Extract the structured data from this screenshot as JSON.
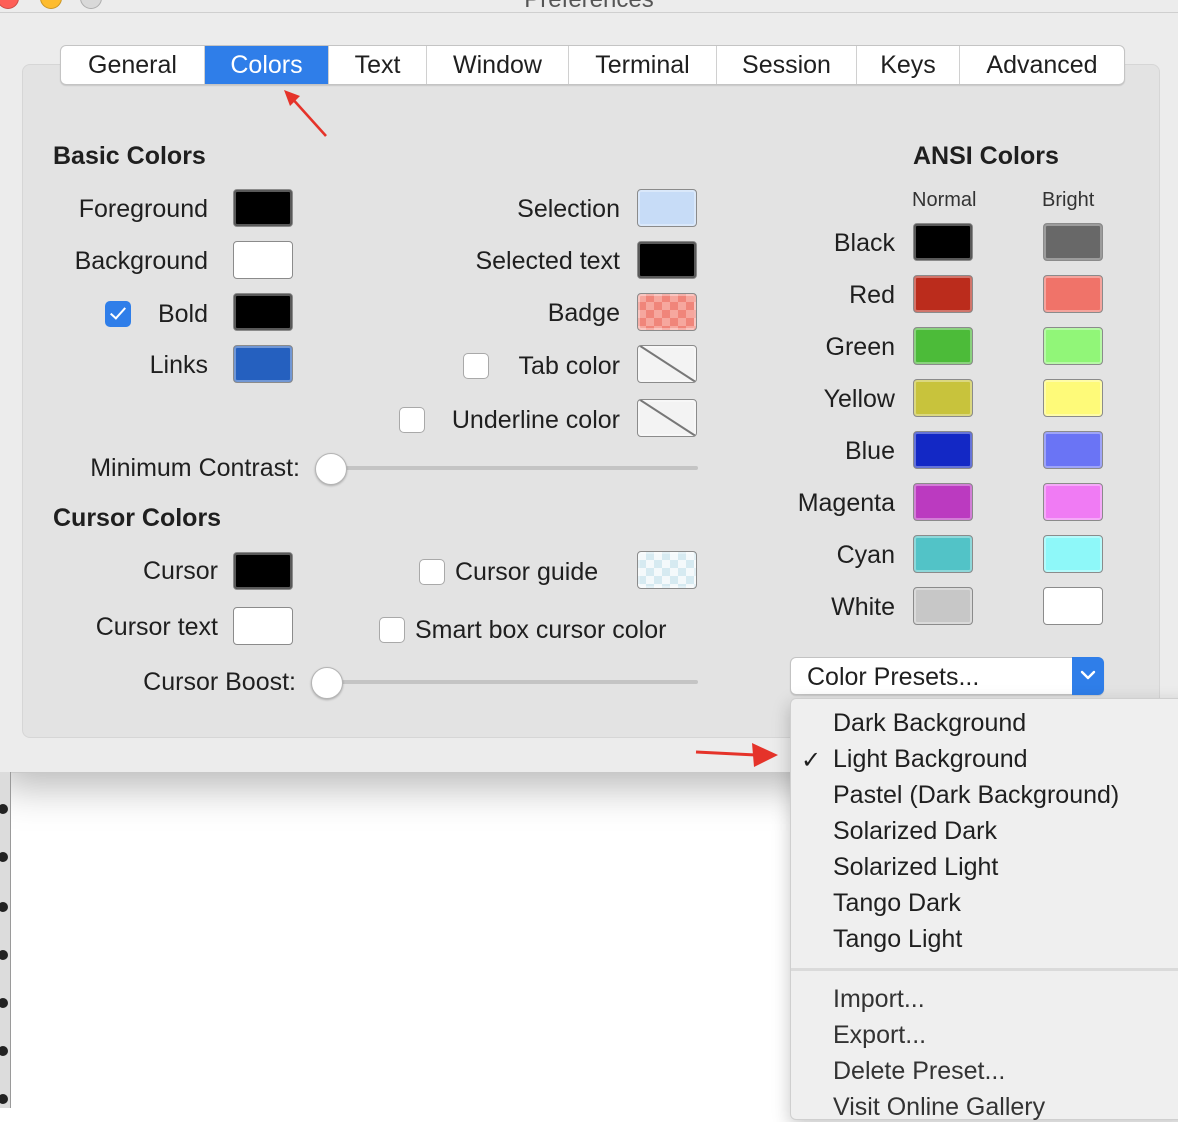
{
  "window": {
    "title": "Preferences"
  },
  "tabs": [
    {
      "label": "General",
      "active": false
    },
    {
      "label": "Colors",
      "active": true
    },
    {
      "label": "Text",
      "active": false
    },
    {
      "label": "Window",
      "active": false
    },
    {
      "label": "Terminal",
      "active": false
    },
    {
      "label": "Session",
      "active": false
    },
    {
      "label": "Keys",
      "active": false
    },
    {
      "label": "Advanced",
      "active": false
    }
  ],
  "basic_colors": {
    "heading": "Basic Colors",
    "foreground": {
      "label": "Foreground",
      "color": "#000000"
    },
    "background": {
      "label": "Background",
      "color": "#ffffff"
    },
    "bold": {
      "label": "Bold",
      "color": "#000000",
      "checked": true
    },
    "links": {
      "label": "Links",
      "color": "#2560bf"
    },
    "selection": {
      "label": "Selection",
      "color": "#c7dcf7"
    },
    "selected_text": {
      "label": "Selected text",
      "color": "#000000"
    },
    "badge": {
      "label": "Badge",
      "color": "#f0857a"
    },
    "tab_color": {
      "label": "Tab color",
      "checked": false
    },
    "underline_color": {
      "label": "Underline color",
      "checked": false
    },
    "min_contrast": {
      "label": "Minimum Contrast:",
      "value": 0
    }
  },
  "cursor_colors": {
    "heading": "Cursor Colors",
    "cursor": {
      "label": "Cursor",
      "color": "#000000"
    },
    "cursor_text": {
      "label": "Cursor text",
      "color": "#ffffff"
    },
    "cursor_guide": {
      "label": "Cursor guide",
      "checked": false,
      "color": "#d6eaf1"
    },
    "smart_box": {
      "label": "Smart box cursor color",
      "checked": false
    },
    "cursor_boost": {
      "label": "Cursor Boost:",
      "value": 0
    }
  },
  "ansi": {
    "heading": "ANSI Colors",
    "normal_label": "Normal",
    "bright_label": "Bright",
    "rows": [
      {
        "name": "Black",
        "normal": "#000000",
        "bright": "#686868"
      },
      {
        "name": "Red",
        "normal": "#bb2c1c",
        "bright": "#f07369"
      },
      {
        "name": "Green",
        "normal": "#4cbb39",
        "bright": "#91f678"
      },
      {
        "name": "Yellow",
        "normal": "#c8c33c",
        "bright": "#fefa79"
      },
      {
        "name": "Blue",
        "normal": "#1328c5",
        "bright": "#6a74f5"
      },
      {
        "name": "Magenta",
        "normal": "#bb3ac0",
        "bright": "#f07bf4"
      },
      {
        "name": "Cyan",
        "normal": "#52c3c7",
        "bright": "#8ef8f9"
      },
      {
        "name": "White",
        "normal": "#c7c7c7",
        "bright": "#ffffff"
      }
    ]
  },
  "presets": {
    "button_label": "Color Presets...",
    "items": [
      {
        "label": "Dark Background",
        "checked": false
      },
      {
        "label": "Light Background",
        "checked": true
      },
      {
        "label": "Pastel (Dark Background)",
        "checked": false
      },
      {
        "label": "Solarized Dark",
        "checked": false
      },
      {
        "label": "Solarized Light",
        "checked": false
      },
      {
        "label": "Tango Dark",
        "checked": false
      },
      {
        "label": "Tango Light",
        "checked": false
      }
    ],
    "actions": [
      {
        "label": "Import..."
      },
      {
        "label": "Export..."
      },
      {
        "label": "Delete Preset..."
      },
      {
        "label": "Visit Online Gallery"
      }
    ],
    "checkmark": "✓"
  },
  "accent_color": "#2f7ee9",
  "annotation_color": "#e5332a"
}
